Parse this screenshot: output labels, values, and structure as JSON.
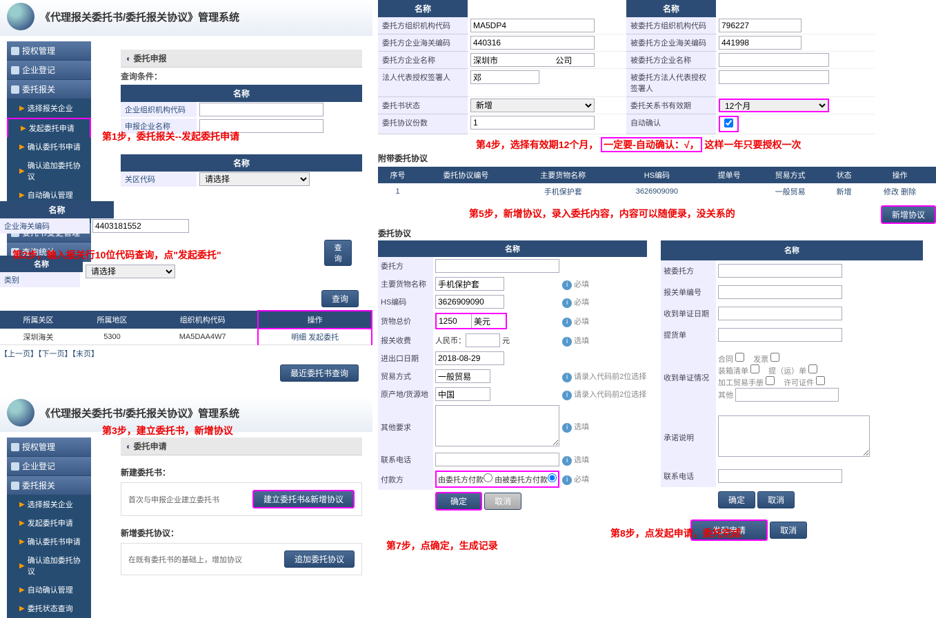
{
  "systemTitle": "《代理报关委托书/委托报关协议》管理系统",
  "sidebar": {
    "primary": [
      "授权管理",
      "企业登记",
      "委托报关",
      "委托书变更管理",
      "查询统计"
    ],
    "children": [
      "选择报关企业",
      "发起委托申请",
      "确认委托书申请",
      "确认追加委托协议",
      "自动确认管理",
      "委托状态查询"
    ],
    "sidebar3Children": [
      "选择报关企业",
      "发起委托申请",
      "确认委托书申请",
      "确认追加委托协议",
      "自动确认管理",
      "委托状态查询"
    ]
  },
  "queryConditionsLabel": "查询条件：",
  "nameHeader": "名称",
  "p1": {
    "sectionTitle": "委托申报",
    "row1Label": "企业组织机构代码",
    "row2Label": "申报企业名称",
    "row3Label": "关区代码",
    "selectPlaceholder": "请选择"
  },
  "p2": {
    "row1Label": "企业海关编码",
    "row1Value": "4403181552",
    "selectPlaceholder": "请选择",
    "classLabel": "类别",
    "queryBtn": "查询",
    "columns": [
      "所属关区",
      "所属地区",
      "组织机构代码",
      "操作"
    ],
    "cells": [
      "深圳海关",
      "5300",
      "MA5DAA4W7",
      "明细 发起委托"
    ],
    "pagerText": "【上一页】【下一页】【末页】",
    "recentBtn": "最近委托书查询"
  },
  "p3": {
    "sectionTitle": "委托申请",
    "newWtsLabel": "新建委托书：",
    "firstTimeText": "首次与申报企业建立委托书",
    "createBtn": "建立委托书&新增协议",
    "addProtocolLabel": "新增委托协议：",
    "existingText": "在既有委托书的基础上，增加协议",
    "appendBtn": "追加委托协议"
  },
  "p4": {
    "labels": [
      [
        "委托方组织机构代码",
        "MA5DP4",
        "被委托方组织机构代码",
        "796227"
      ],
      [
        "委托方企业海关编码",
        "440316",
        "被委托方企业海关编码",
        "441998"
      ],
      [
        "委托方企业名称",
        "深圳市                         公司",
        "被委托方企业名称",
        ""
      ],
      [
        "法人代表授权签署人",
        "邓",
        "被委托方法人代表授权签署人",
        ""
      ],
      [
        "委托书状态",
        "新增",
        "委托关系书有效期",
        "12个月"
      ],
      [
        "委托协议份数",
        "1",
        "自动确认",
        ""
      ]
    ],
    "attachTitle": "附带委托协议",
    "columns": [
      "序号",
      "委托协议编号",
      "主要货物名称",
      "HS编码",
      "提单号",
      "贸易方式",
      "状态",
      "操作"
    ],
    "row": [
      "1",
      "",
      "手机保护套",
      "3626909090",
      "",
      "一般贸易",
      "新增",
      "修改 删除"
    ],
    "newProtocolBtn": "新增协议"
  },
  "p5": {
    "title": "委托协议",
    "leftRows": {
      "wtf": "委托方",
      "goods": "主要货物名称",
      "goodsVal": "手机保护套",
      "goodsReq": "必填",
      "hs": "HS编码",
      "hsVal": "3626909090",
      "hsReq": "必填",
      "total": "货物总价",
      "totalVal": "1250",
      "currency": "美元",
      "totalReq": "必填",
      "fee": "报关收费",
      "feeUnit": "人民币：",
      "feeYuan": "元",
      "feeOpt": "选填",
      "date": "进出口日期",
      "dateVal": "2018-08-29",
      "trade": "贸易方式",
      "tradeVal": "一般贸易",
      "tradeHint": "请录入代码前2位选择",
      "origin": "原产地/货源地",
      "originVal": "中国",
      "originHint": "请录入代码前2位选择",
      "other": "其他要求",
      "otherOpt": "选填",
      "phone": "联系电话",
      "phoneOpt": "选填",
      "payer": "付款方",
      "payerOpt1": "由委托方付款",
      "payerOpt2": "由被委托方付款",
      "payerReq": "必填",
      "okBtn": "确定",
      "cancelBtn": "取消"
    },
    "rightRows": {
      "bwf": "被委托方",
      "bgdh": "报关单编号",
      "sdrz": "收到单证日期",
      "tdh": "提货单",
      "sdzq": "收到单证情况",
      "chkList": [
        "合同",
        "发票",
        "装箱清单",
        "提（运）单",
        "加工贸易手册",
        "许可证件"
      ],
      "other": "其他",
      "cnsm": "承诺说明",
      "phone": "联系电话",
      "okBtn": "确定",
      "cancelBtn": "取消"
    },
    "launchBtn": "发起申请",
    "cancelFinal": "取消"
  },
  "annotations": {
    "step1": "第1步，委托报关--发起委托申请",
    "step2": "第2步，输入报关行10位代码查询，点\"发起委托\"",
    "step3": "第3步，建立委托书，新增协议",
    "step4a": "第4步，选择有效期12个月，",
    "step4b": "一定要-自动确认：√，",
    "step4c": "这样一年只要授权一次",
    "step5": "第5步，新增协议，录入委托内容，内容可以随便录，没关系的",
    "step7": "第7步，点确定，生成记录",
    "step8": "第8步，点发起申请，委托完成"
  }
}
